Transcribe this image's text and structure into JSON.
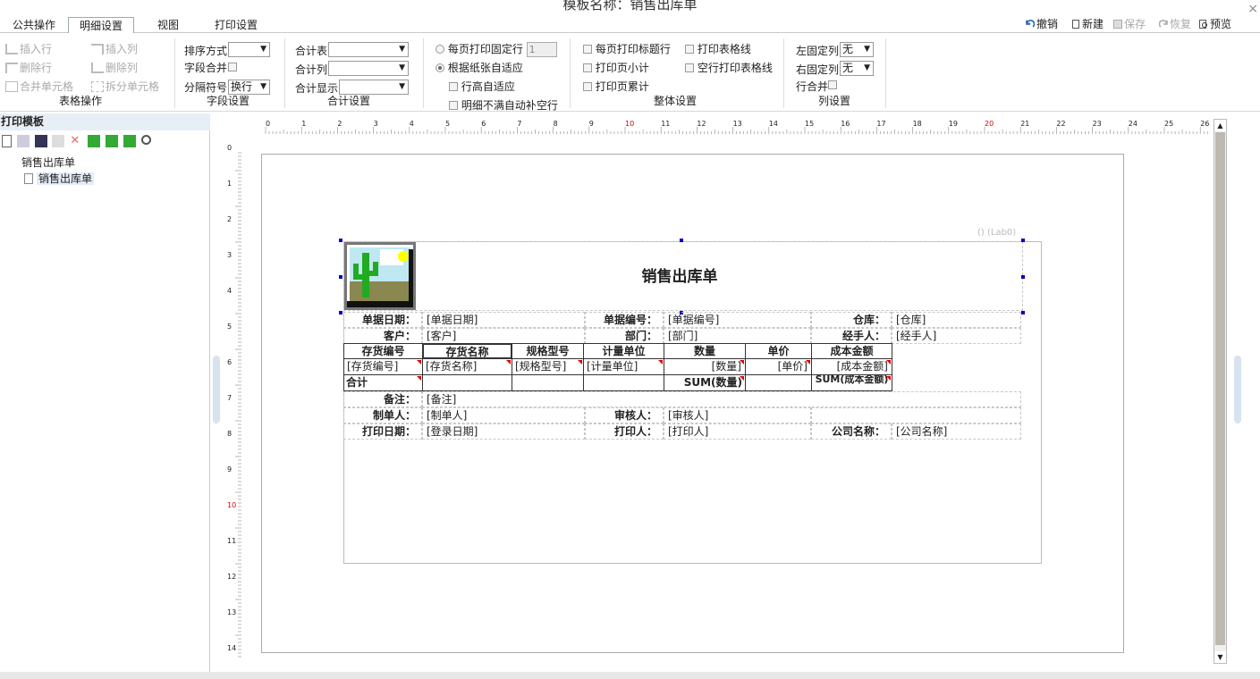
{
  "window": {
    "title": "模板名称：销售出库单",
    "close": "×"
  },
  "tabs": [
    "公共操作",
    "明细设置",
    "视图",
    "打印设置"
  ],
  "toolbar": {
    "undo": "撤销",
    "new": "新建",
    "save": "保存",
    "restore": "恢复",
    "preview": "预览"
  },
  "ribbon": {
    "table_ops": {
      "insert_row": "插入行",
      "insert_col": "插入列",
      "delete_row": "删除行",
      "delete_col": "删除列",
      "merge": "合并单元格",
      "split": "拆分单元格",
      "label": "表格操作"
    },
    "field": {
      "sort": "排序方式",
      "sort_value": "",
      "merge": "字段合并",
      "sep": "分隔符号",
      "sep_value": "换行",
      "label": "字段设置"
    },
    "total": {
      "table": "合计表",
      "table_value": "",
      "col": "合计列",
      "col_value": "",
      "display": "合计显示",
      "display_value": "",
      "label": "合计设置"
    },
    "page": {
      "fixed": "每页打印固定行",
      "fixed_value": "1",
      "auto": "根据纸张自适应",
      "row_auto": "行高自适应",
      "fill": "明细不满自动补空行"
    },
    "whole": {
      "title_row": "每页打印标题行",
      "grid": "打印表格线",
      "subtotal": "打印页小计",
      "empty_grid": "空行打印表格线",
      "cumulative": "打印页累计",
      "label": "整体设置"
    },
    "cols": {
      "left_fixed": "左固定列",
      "left_value": "无",
      "right_fixed": "右固定列",
      "right_value": "无",
      "row_merge": "行合并",
      "label": "列设置"
    }
  },
  "left": {
    "title": "打印模板",
    "tree_root": "销售出库单",
    "tree_child": "销售出库单"
  },
  "ruler": {
    "h": [
      "0",
      "1",
      "2",
      "3",
      "4",
      "5",
      "6",
      "7",
      "8",
      "9",
      "10",
      "11",
      "12",
      "13",
      "14",
      "15",
      "16",
      "17",
      "18",
      "19",
      "20",
      "21",
      "22",
      "23",
      "24",
      "25",
      "26"
    ],
    "v": [
      "0",
      "1",
      "2",
      "3",
      "4",
      "5",
      "6",
      "7",
      "8",
      "9",
      "10",
      "11",
      "12",
      "13",
      "14"
    ]
  },
  "form": {
    "lab": "() (Lab0)",
    "title": "销售出库单",
    "row1": [
      "单据日期：",
      "[单据日期]",
      "单据编号：",
      "[单据编号]",
      "仓库：",
      "[仓库]"
    ],
    "row2": [
      "客户：",
      "[客户]",
      "部门：",
      "[部门]",
      "经手人：",
      "[经手人]"
    ],
    "headers": [
      "存货编号",
      "存货名称",
      "规格型号",
      "计量单位",
      "数量",
      "单价",
      "成本金额"
    ],
    "detail": [
      "[存货编号]",
      "[存货名称]",
      "[规格型号]",
      "[计量单位]",
      "[数量]",
      "[单价]",
      "[成本金额]"
    ],
    "total": [
      "合计",
      "SUM(数量)",
      "SUM(成本金额)"
    ],
    "remark": [
      "备注：",
      "[备注]"
    ],
    "maker": [
      "制单人：",
      "[制单人]",
      "审核人：",
      "[审核人]"
    ],
    "print": [
      "打印日期：",
      "[登录日期]",
      "打印人：",
      "[打印人]",
      "公司名称：",
      "[公司名称]"
    ]
  }
}
